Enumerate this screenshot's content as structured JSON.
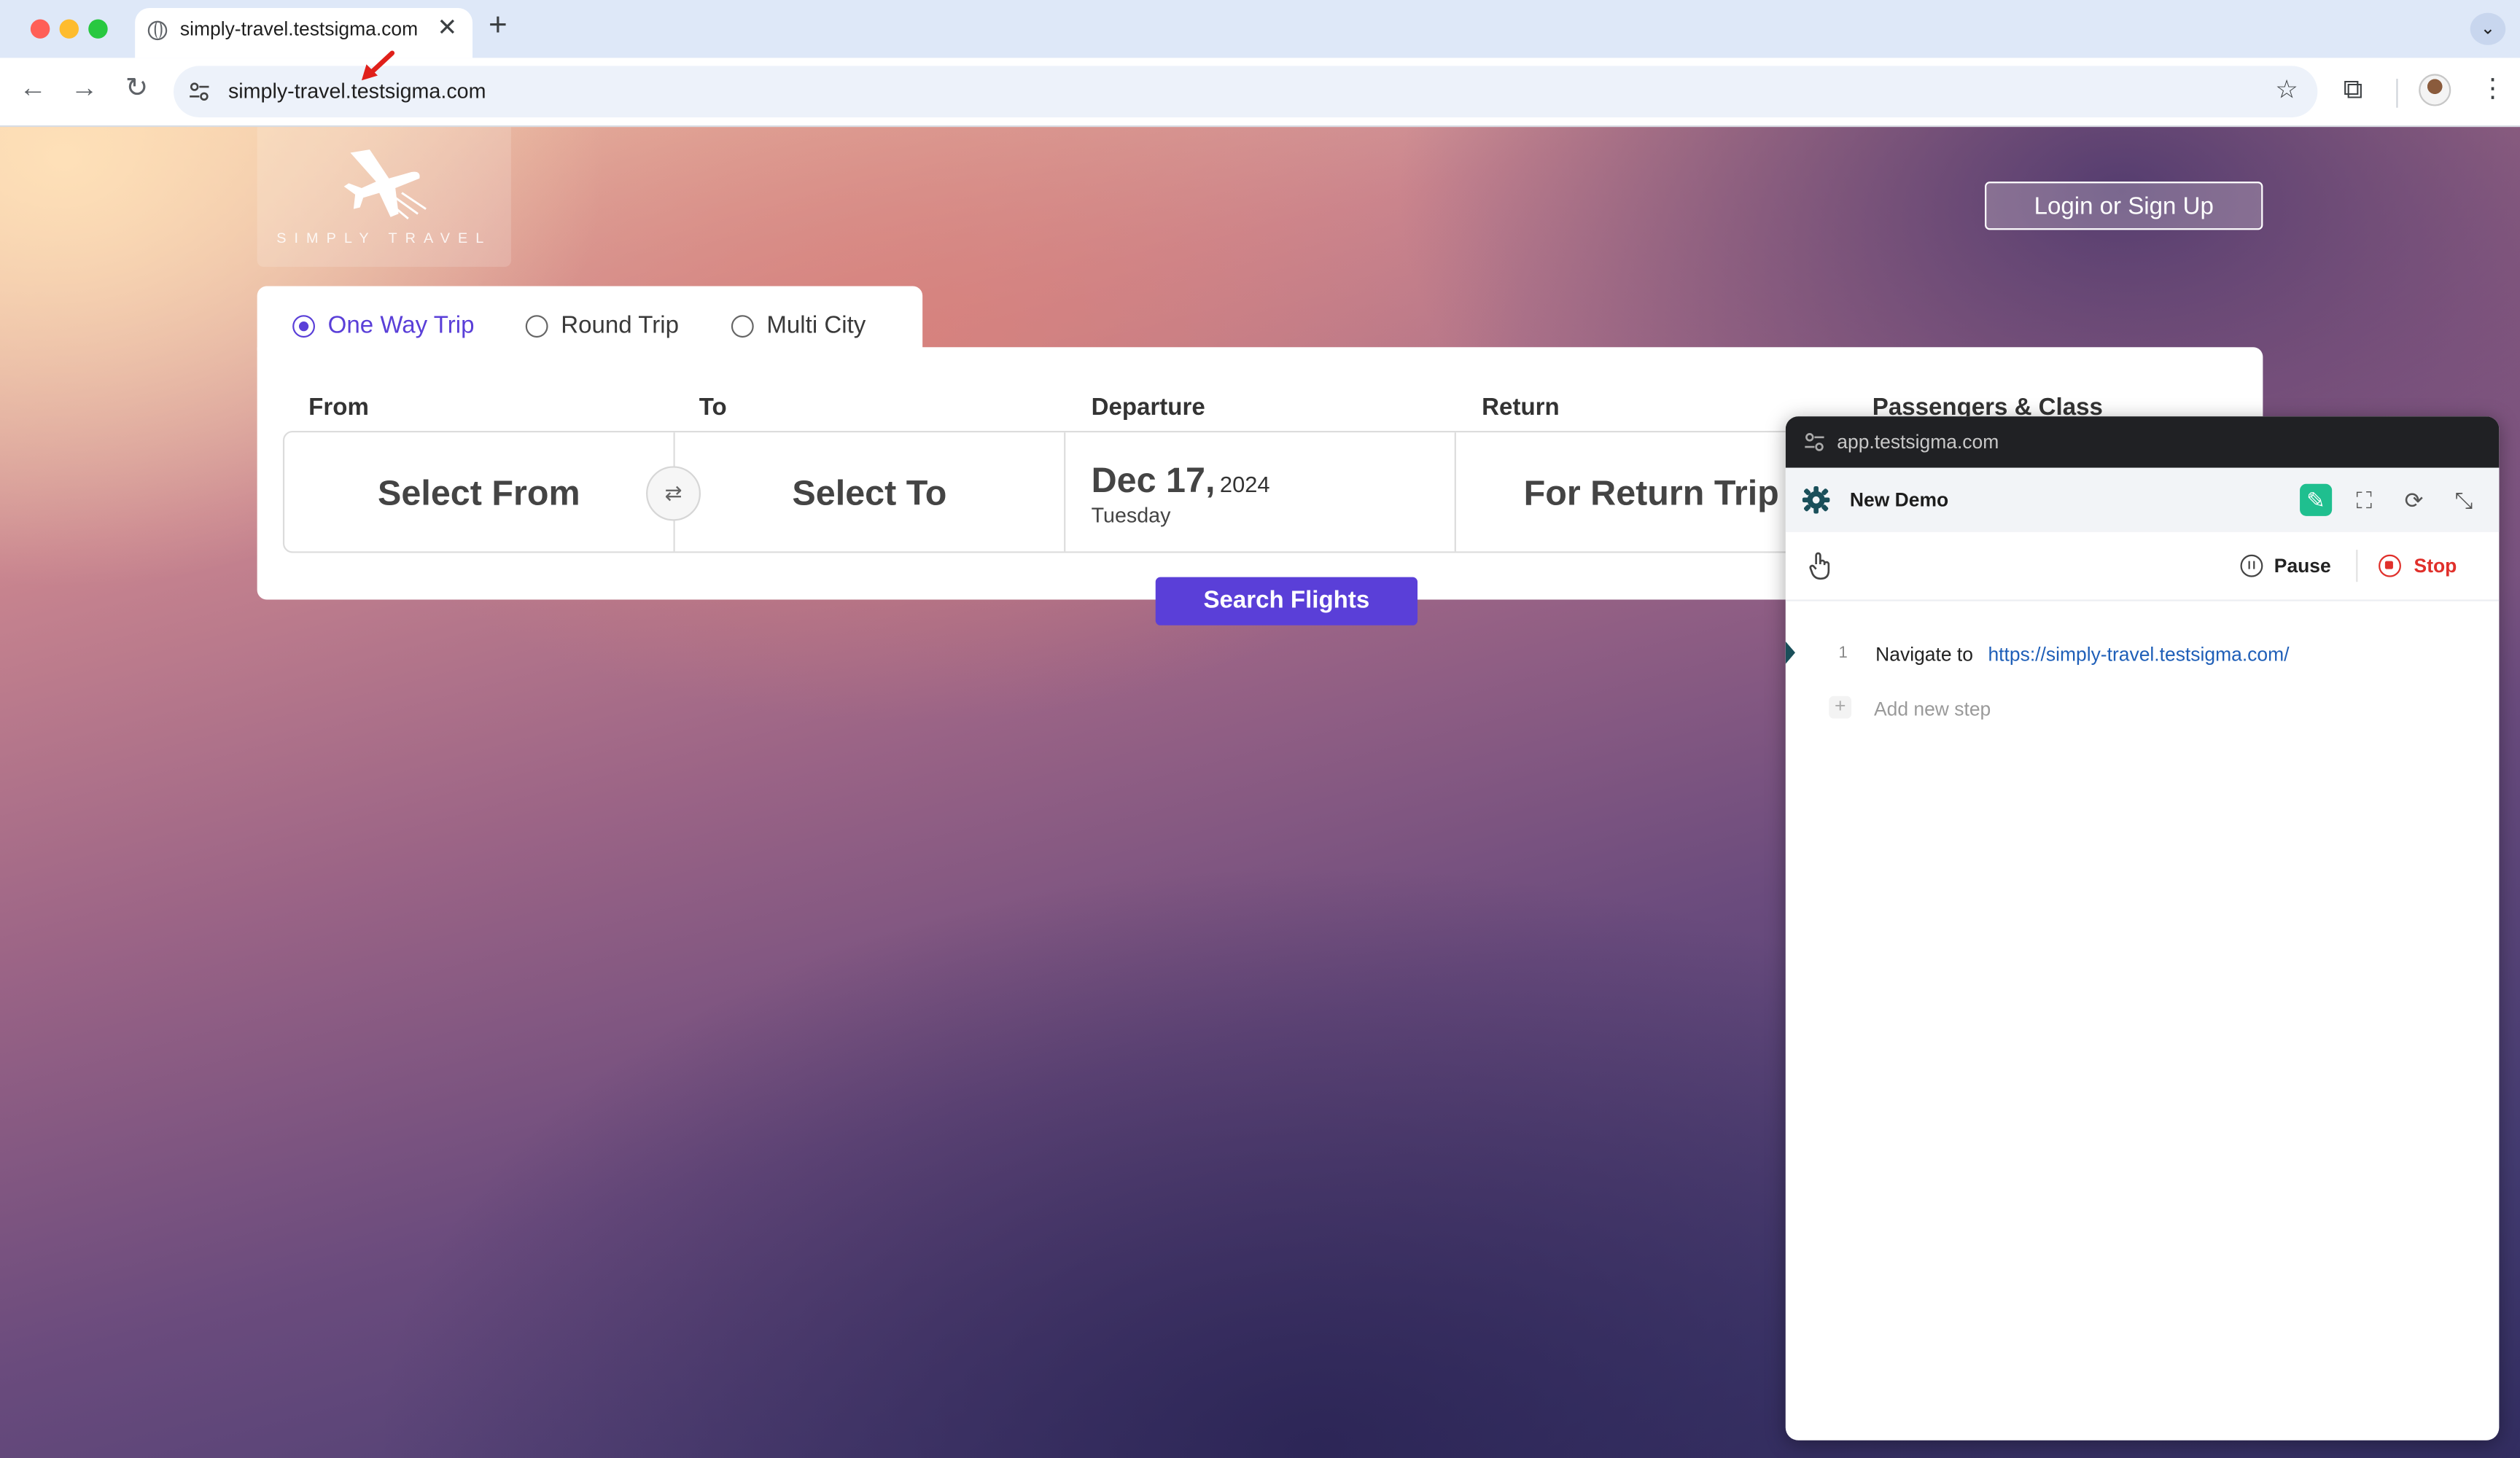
{
  "browser": {
    "tab_title": "simply-travel.testsigma.com",
    "tab_close": "✕",
    "new_tab": "+",
    "tab_menu": "⌄",
    "back": "←",
    "forward": "→",
    "reload": "↻",
    "url": "simply-travel.testsigma.com",
    "bookmark": "☆",
    "extensions": "⧉",
    "menu": "⋮",
    "traffic_colors": [
      "#ff5f57",
      "#febc2e",
      "#28c840"
    ]
  },
  "site": {
    "logo_text": "SIMPLY TRAVEL",
    "login_label": "Login or Sign Up",
    "trip_types": [
      {
        "label": "One Way Trip",
        "selected": true
      },
      {
        "label": "Round Trip",
        "selected": false
      },
      {
        "label": "Multi City",
        "selected": false
      }
    ],
    "labels": {
      "from": "From",
      "to": "To",
      "departure": "Departure",
      "return": "Return",
      "passengers": "Passengers & Class"
    },
    "from_value": "Select From",
    "swap_icon": "⇄",
    "to_value": "Select To",
    "departure": {
      "day": "Dec 17,",
      "year": "2024",
      "weekday": "Tuesday"
    },
    "return_value": "For Return Trip",
    "search_button": "Search Flights",
    "accent_color": "#5a3fd8"
  },
  "recorder": {
    "url": "app.testsigma.com",
    "title": "New Demo",
    "header_icons": {
      "edit": "✎",
      "capture": "⛶",
      "refresh": "⟳",
      "minimize": "⤡"
    },
    "pause_label": "Pause",
    "stop_label": "Stop",
    "steps": [
      {
        "number": "1",
        "action": "Navigate to",
        "value": "https://simply-travel.testsigma.com/"
      }
    ],
    "add_plus": "+",
    "add_step_label": "Add new step",
    "stop_color": "#e0302b",
    "brand_color": "#1fbf8f"
  }
}
